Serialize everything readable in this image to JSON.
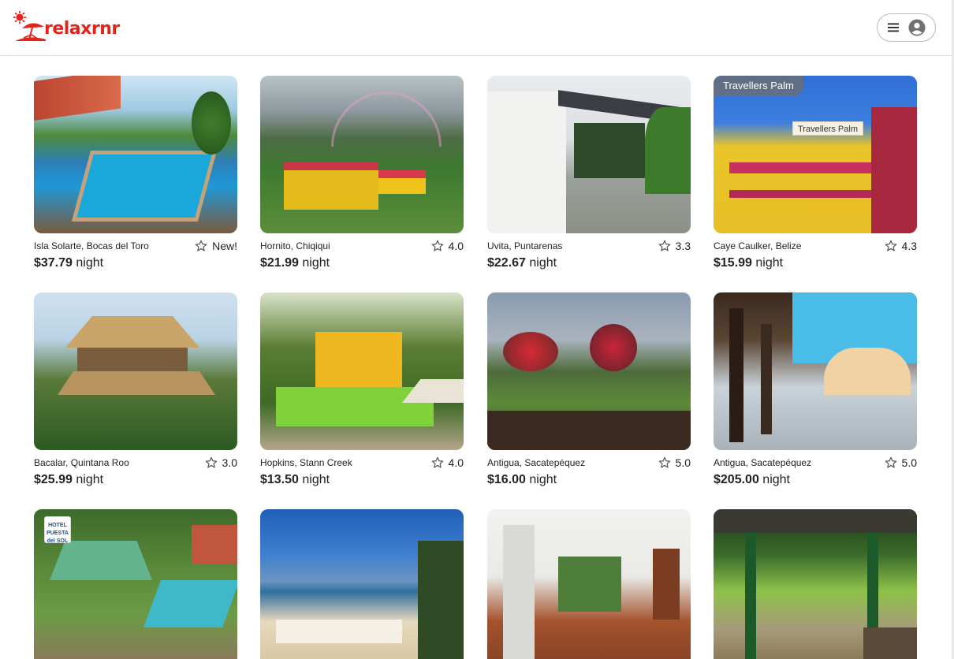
{
  "app": {
    "logo_text": "relaxrnr"
  },
  "colors": {
    "brand": "#e3241b",
    "border": "#dddddd"
  },
  "icons": {
    "menu": "hamburger-menu-icon",
    "account": "user-circle-icon",
    "rating": "star-outline-icon"
  },
  "listings": [
    {
      "location": "Isla Solarte, Bocas del Toro",
      "rating": "New!",
      "price": "$37.79",
      "unit": "night"
    },
    {
      "location": "Hornito, Chiqiqui",
      "rating": "4.0",
      "price": "$21.99",
      "unit": "night"
    },
    {
      "location": "Uvita, Puntarenas",
      "rating": "3.3",
      "price": "$22.67",
      "unit": "night"
    },
    {
      "location": "Caye Caulker, Belize",
      "rating": "4.3",
      "price": "$15.99",
      "unit": "night",
      "badge": "Travellers Palm",
      "tooltip": "Travellers Palm"
    },
    {
      "location": "Bacalar, Quintana Roo",
      "rating": "3.0",
      "price": "$25.99",
      "unit": "night"
    },
    {
      "location": "Hopkins, Stann Creek",
      "rating": "4.0",
      "price": "$13.50",
      "unit": "night"
    },
    {
      "location": "Antigua, Sacatepéquez",
      "rating": "5.0",
      "price": "$16.00",
      "unit": "night"
    },
    {
      "location": "Antigua, Sacatepéquez",
      "rating": "5.0",
      "price": "$205.00",
      "unit": "night"
    },
    {
      "sign": "HOTEL PUESTA del SOL"
    },
    {},
    {},
    {}
  ]
}
